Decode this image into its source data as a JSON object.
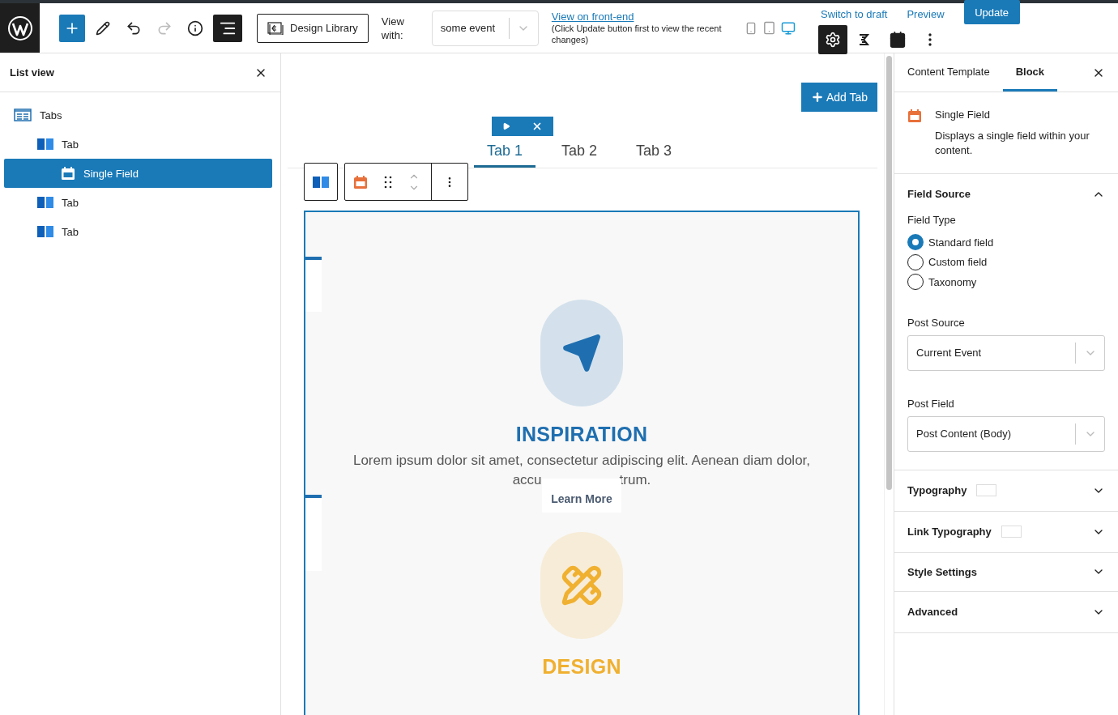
{
  "toolbar": {
    "buttons": [
      {
        "kind": "add",
        "selected": false,
        "disabled": false
      },
      {
        "kind": "edit",
        "selected": false,
        "disabled": false
      },
      {
        "kind": "undo",
        "selected": false,
        "disabled": false
      },
      {
        "kind": "redo",
        "selected": false,
        "disabled": true
      },
      {
        "kind": "info",
        "selected": false,
        "disabled": false
      },
      {
        "kind": "list",
        "selected": true,
        "disabled": false
      }
    ],
    "design_library": "Design Library",
    "view_with_label": "View with:",
    "view_with_value": "some event",
    "front_end_link": "View on front-end",
    "front_end_note": "(Click Update button first to view the recent changes)",
    "devices": [
      {
        "kind": "mobile",
        "selected": false
      },
      {
        "kind": "tablet",
        "selected": false
      },
      {
        "kind": "desktop",
        "selected": true
      }
    ],
    "switch_to_draft": "Switch to draft",
    "preview": "Preview",
    "update": "Update",
    "panel_buttons": [
      {
        "kind": "settings",
        "selected": true
      },
      {
        "kind": "kadence",
        "selected": false
      },
      {
        "kind": "calendar",
        "selected": false
      },
      {
        "kind": "more",
        "selected": false
      }
    ]
  },
  "list_view": {
    "title": "List view",
    "items": [
      {
        "label": "Tabs",
        "kind": "tabs",
        "selected": false,
        "children": [
          {
            "label": "Tab",
            "kind": "tab",
            "selected": false,
            "children": [
              {
                "label": "Single Field",
                "kind": "field",
                "selected": true
              }
            ]
          },
          {
            "label": "Tab",
            "kind": "tab",
            "selected": false
          },
          {
            "label": "Tab",
            "kind": "tab",
            "selected": false
          }
        ]
      }
    ]
  },
  "editor": {
    "add_tab": "Add Tab",
    "tabs": [
      {
        "label": "Tab 1",
        "selected": true
      },
      {
        "label": "Tab 2",
        "selected": false
      },
      {
        "label": "Tab 3",
        "selected": false
      }
    ],
    "features": [
      {
        "kind": "send",
        "color": "#1f6fb0",
        "title": "INSPIRATION",
        "description": "Lorem ipsum dolor sit amet, consectetur adipiscing elit. Aenean diam dolor,",
        "description_fragments": [
          "accu",
          "trum."
        ],
        "button": "Learn More"
      },
      {
        "kind": "tools",
        "color": "#f0b030",
        "title": "DESIGN"
      }
    ]
  },
  "sidebar": {
    "tabs": [
      {
        "label": "Content Template",
        "selected": false
      },
      {
        "label": "Block",
        "selected": true
      }
    ],
    "block": {
      "name": "Single Field",
      "description": "Displays a single field within your content."
    },
    "panels": [
      {
        "title": "Field Source",
        "expanded": true,
        "swatch": false,
        "field_type_label": "Field Type",
        "options": [
          {
            "label": "Standard field",
            "selected": true
          },
          {
            "label": "Custom field",
            "selected": false
          },
          {
            "label": "Taxonomy",
            "selected": false
          }
        ],
        "selects": [
          {
            "label": "Post Source",
            "value": "Current Event"
          },
          {
            "label": "Post Field",
            "value": "Post Content (Body)"
          }
        ]
      },
      {
        "title": "Typography",
        "expanded": false,
        "swatch": true
      },
      {
        "title": "Link Typography",
        "expanded": false,
        "swatch": true
      },
      {
        "title": "Style Settings",
        "expanded": false,
        "swatch": false
      },
      {
        "title": "Advanced",
        "expanded": false,
        "swatch": false
      }
    ]
  }
}
